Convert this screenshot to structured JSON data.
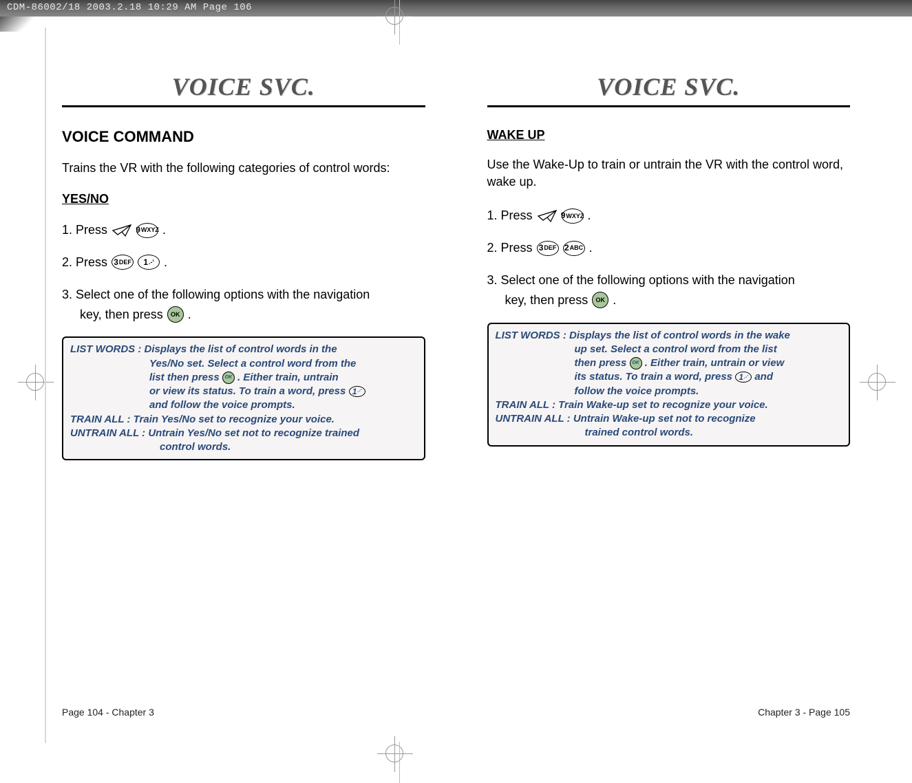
{
  "scan_header": "CDM-86002/18  2003.2.18  10:29 AM  Page 106",
  "titles": {
    "left": "VOICE SVC.",
    "right": "VOICE SVC."
  },
  "left": {
    "heading": "VOICE COMMAND",
    "intro": "Trains the VR with the following categories of control words:",
    "sub": "YES/NO",
    "step1_a": "1. Press",
    "step1_b": ".",
    "step2_a": "2. Press",
    "step2_b": ".",
    "step3_a": "3. Select one of the following options with the navigation",
    "step3_b": "key, then press",
    "step3_c": ".",
    "box": {
      "lw_label": "LIST WORDS : ",
      "lw_1": "Displays the list of control words in the",
      "lw_2": "Yes/No set. Select a control word from the",
      "lw_3a": "list then press ",
      "lw_3b": " . Either train, untrain",
      "lw_4a": "or view its status. To train a word, press ",
      "lw_5": "and follow the voice prompts.",
      "ta": "TRAIN ALL : Train Yes/No set to recognize your voice.",
      "ua_1": "UNTRAIN ALL : Untrain Yes/No set not to recognize trained",
      "ua_2": "control words."
    },
    "footer": "Page 104 - Chapter 3"
  },
  "right": {
    "sub": "WAKE UP",
    "intro": "Use the Wake-Up to train or untrain the VR with the control word, wake up.",
    "step1_a": "1. Press",
    "step1_b": ".",
    "step2_a": "2. Press",
    "step2_b": ".",
    "step3_a": "3. Select one of the following options with the navigation",
    "step3_b": "key, then press",
    "step3_c": ".",
    "box": {
      "lw_label": "LIST WORDS : ",
      "lw_1": "Displays the list of control words in the wake",
      "lw_2": "up set. Select a control word from the list",
      "lw_3a": "then press ",
      "lw_3b": " . Either train, untrain or view",
      "lw_4a": "its status. To train a word, press ",
      "lw_4b": " and",
      "lw_5": "follow the voice prompts.",
      "ta": "TRAIN ALL : Train Wake-up set to recognize your voice.",
      "ua_1": "UNTRAIN ALL : Untrain Wake-up set not to recognize",
      "ua_2": "trained control words."
    },
    "footer": "Chapter 3 - Page 105"
  },
  "keys": {
    "k1": "1",
    "k1s": ".-'",
    "k2": "2",
    "k2s": "ABC",
    "k3": "3",
    "k3s": "DEF",
    "k9": "9",
    "k9s": "WXYZ",
    "ok": "OK"
  }
}
